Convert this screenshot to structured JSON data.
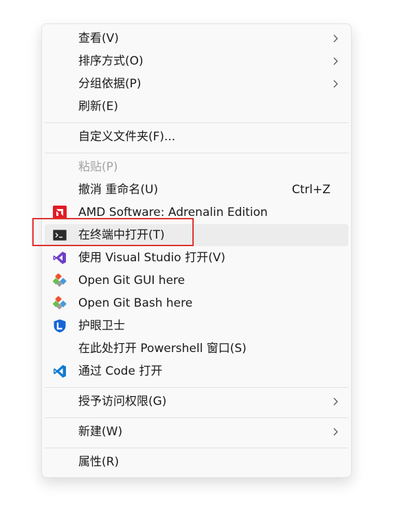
{
  "menu": {
    "view": "查看(V)",
    "sort": "排序方式(O)",
    "group": "分组依据(P)",
    "refresh": "刷新(E)",
    "customize": "自定义文件夹(F)...",
    "paste": "粘贴(P)",
    "undo": "撤消 重命名(U)",
    "undo_shortcut": "Ctrl+Z",
    "amd": "AMD Software: Adrenalin Edition",
    "terminal": "在终端中打开(T)",
    "visual_studio": "使用 Visual Studio 打开(V)",
    "git_gui": "Open Git GUI here",
    "git_bash": "Open Git Bash here",
    "eye_guard": "护眼卫士",
    "powershell": "在此处打开 Powershell 窗口(S)",
    "vscode": "通过 Code 打开",
    "grant_access": "授予访问权限(G)",
    "new": "新建(W)",
    "properties": "属性(R)"
  },
  "colors": {
    "highlight_border": "#e03030",
    "amd_red": "#e31b23",
    "vs_purple": "#6e3fc8",
    "git_orange": "#f05133",
    "vscode_blue": "#0f7ad1"
  }
}
